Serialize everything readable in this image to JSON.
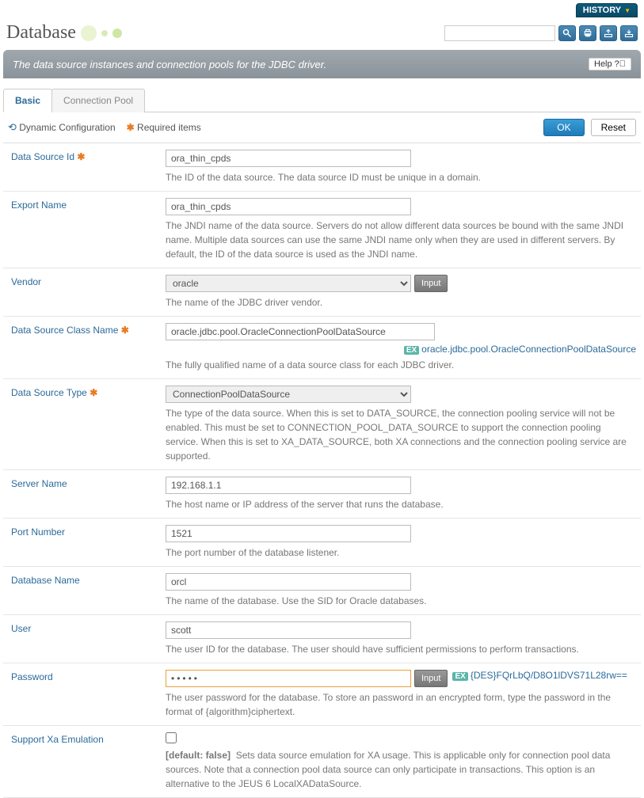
{
  "topbar": {
    "history": "HISTORY"
  },
  "header": {
    "title": "Database"
  },
  "banner": {
    "text": "The data source instances and connection pools for the JDBC driver.",
    "help": "Help"
  },
  "tabs": [
    {
      "label": "Basic",
      "active": true
    },
    {
      "label": "Connection Pool",
      "active": false
    }
  ],
  "toolbar": {
    "dynamic": "Dynamic Configuration",
    "required": "Required items",
    "ok": "OK",
    "reset": "Reset"
  },
  "fields": {
    "data_source_id": {
      "label": "Data Source Id",
      "value": "ora_thin_cpds",
      "desc": "The ID of the data source. The data source ID must be unique in a domain."
    },
    "export_name": {
      "label": "Export Name",
      "value": "ora_thin_cpds",
      "desc": "The JNDI name of the data source. Servers do not allow different data sources be bound with the same JNDI name. Multiple data sources can use the same JNDI name only when they are used in different servers. By default, the ID of the data source is used as the JNDI name."
    },
    "vendor": {
      "label": "Vendor",
      "value": "oracle",
      "input_btn": "Input",
      "desc": "The name of the JDBC driver vendor."
    },
    "ds_class": {
      "label": "Data Source Class Name",
      "value": "oracle.jdbc.pool.OracleConnectionPoolDataSource",
      "ex_label": "EX",
      "ex": "oracle.jdbc.pool.OracleConnectionPoolDataSource",
      "desc": "The fully qualified name of a data source class for each JDBC driver."
    },
    "ds_type": {
      "label": "Data Source Type",
      "value": "ConnectionPoolDataSource",
      "desc": "The type of the data source. When this is set to DATA_SOURCE, the connection pooling service will not be enabled. This must be set to CONNECTION_POOL_DATA_SOURCE to support the connection pooling service. When this is set to XA_DATA_SOURCE, both XA connections and the connection pooling service are supported."
    },
    "server_name": {
      "label": "Server Name",
      "value": "192.168.1.1",
      "desc": "The host name or IP address of the server that runs the database."
    },
    "port": {
      "label": "Port Number",
      "value": "1521",
      "desc": "The port number of the database listener."
    },
    "db_name": {
      "label": "Database Name",
      "value": "orcl",
      "desc": "The name of the database. Use the SID for Oracle databases."
    },
    "user": {
      "label": "User",
      "value": "scott",
      "desc": "The user ID for the database. The user should have sufficient permissions to perform transactions."
    },
    "password": {
      "label": "Password",
      "value": "•••••",
      "input_btn": "Input",
      "ex_label": "EX",
      "hash": "{DES}FQrLbQ/D8O1lDVS71L28rw==",
      "desc": "The user password for the database. To store an password in an encrypted form, type the password in the format of {algorithm}ciphertext."
    },
    "xa": {
      "label": "Support Xa Emulation",
      "default": "[default: false]",
      "desc": "Sets data source emulation for XA usage. This is applicable only for connection pool data sources. Note that a connection pool data source can only participate in transactions. This option is an alternative to the JEUS 6 LocalXADataSource."
    }
  }
}
